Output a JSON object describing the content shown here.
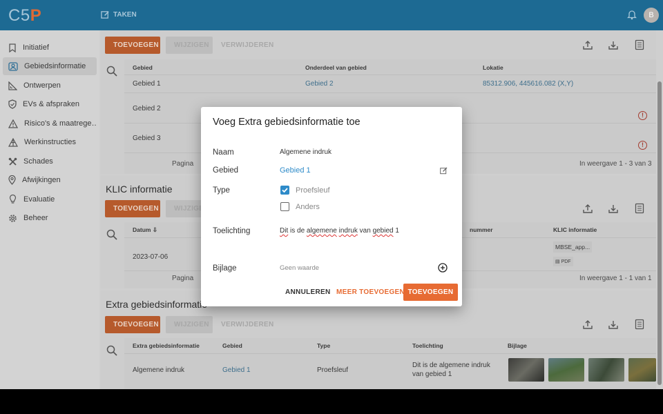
{
  "header": {
    "logo_text": "C5",
    "logo_accent": "P",
    "taken_label": "TAKEN",
    "avatar_initial": "B"
  },
  "sidebar": {
    "items": [
      {
        "label": "Initiatief",
        "icon": "bookmark-icon"
      },
      {
        "label": "Gebiedsinformatie",
        "icon": "map-user-icon"
      },
      {
        "label": "Ontwerpen",
        "icon": "ruler-triangle-icon"
      },
      {
        "label": "EVs & afspraken",
        "icon": "shield-check-icon"
      },
      {
        "label": "Risico's & maatrege…",
        "icon": "warning-icon"
      },
      {
        "label": "Werkinstructies",
        "icon": "network-icon"
      },
      {
        "label": "Schades",
        "icon": "tools-icon"
      },
      {
        "label": "Afwijkingen",
        "icon": "location-icon"
      },
      {
        "label": "Evaluatie",
        "icon": "lightbulb-icon"
      },
      {
        "label": "Beheer",
        "icon": "gear-icon"
      }
    ]
  },
  "sections": {
    "gebied": {
      "add_label": "TOEVOEGEN",
      "edit_label": "WIJZIGEN",
      "delete_label": "VERWIJDEREN",
      "columns": [
        "Gebied",
        "Onderdeel van gebied",
        "Lokatie"
      ],
      "rows": [
        {
          "gebied": "Gebied 1",
          "onderdeel": "Gebied 2",
          "lokatie": "85312.906, 445616.082 (X,Y)"
        },
        {
          "gebied": "Gebied 2",
          "onderdeel": "",
          "lokatie": ""
        },
        {
          "gebied": "Gebied 3",
          "onderdeel": "",
          "lokatie": ""
        }
      ],
      "pagination_label": "Pagina",
      "range_text": "In weergave 1 - 3 van 3"
    },
    "klic": {
      "title": "KLIC informatie",
      "add_label": "TOEVOEGEN",
      "edit_label": "WIJZIGEN",
      "columns": [
        "Datum",
        "nummer",
        "KLIC informatie"
      ],
      "rows": [
        {
          "datum": "2023-07-06",
          "file": "MBSE_app...",
          "file_type": "PDF"
        }
      ],
      "pagination_label": "Pagina",
      "range_text": "In weergave 1 - 1 van 1"
    },
    "extra": {
      "title": "Extra gebiedsinformatie",
      "add_label": "TOEVOEGEN",
      "edit_label": "WIJZIGEN",
      "delete_label": "VERWIJDEREN",
      "columns": [
        "Extra gebiedsinformatie",
        "Gebied",
        "Type",
        "Toelichting",
        "Bijlage"
      ],
      "rows": [
        {
          "info": "Algemene indruk",
          "gebied": "Gebied 1",
          "type": "Proefsleuf",
          "toelichting_1": "Dit is de algemene indruk",
          "toelichting_2": "van gebied 1"
        }
      ]
    }
  },
  "dialog": {
    "title": "Voeg Extra gebiedsinformatie toe",
    "naam_label": "Naam",
    "naam_value": "Algemene indruk",
    "gebied_label": "Gebied",
    "gebied_value": "Gebied 1",
    "type_label": "Type",
    "type_options": [
      {
        "label": "Proefsleuf",
        "checked": true
      },
      {
        "label": "Anders",
        "checked": false
      }
    ],
    "toelichting_label": "Toelichting",
    "toelichting_parts": [
      "Dit",
      " is de ",
      "algemene",
      " ",
      "indruk",
      " van ",
      "gebied",
      " 1"
    ],
    "bijlage_label": "Bijlage",
    "bijlage_placeholder": "Geen waarde",
    "cancel_label": "ANNULEREN",
    "more_label": "MEER TOEVOEGEN",
    "submit_label": "TOEVOEGEN"
  },
  "colors": {
    "header": "#1d6a93",
    "accent": "#e76b33",
    "link": "#2e8bc9",
    "error": "#a33b2e"
  }
}
